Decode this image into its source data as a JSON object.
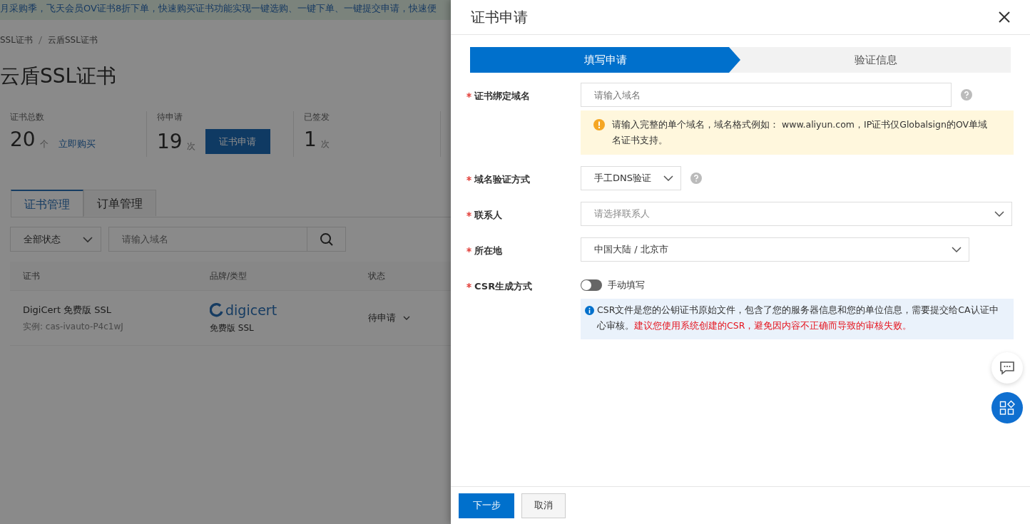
{
  "background_page": {
    "banner": "月采购季，飞天会员OV证书8折下单，快速购买证书功能实现一键选购、一键下单、一键提交申请，快速便",
    "breadcrumb": [
      "SSL证书",
      "云盾SSL证书"
    ],
    "title": "云盾SSL证书",
    "stats": [
      {
        "label": "证书总数",
        "value": "20",
        "unit": "个",
        "action": {
          "kind": "link",
          "text": "立即购买"
        }
      },
      {
        "label": "待申请",
        "value": "19",
        "unit": "次",
        "action": {
          "kind": "button",
          "text": "证书申请"
        }
      },
      {
        "label": "已签发",
        "value": "1",
        "unit": "次"
      }
    ],
    "tabs": [
      {
        "label": "证书管理",
        "selected": true
      },
      {
        "label": "订单管理",
        "selected": false
      }
    ],
    "status_filter": "全部状态",
    "search": {
      "placeholder": "请输入域名"
    },
    "table": {
      "columns": [
        "证书",
        "品牌/类型",
        "状态"
      ],
      "rows": [
        {
          "name": "DigiCert 免费版 SSL",
          "instance": "实例: cas-ivauto-P4c1wJ",
          "brand": "digicert",
          "type": "免费版 SSL",
          "status": "待申请"
        }
      ]
    }
  },
  "drawer": {
    "title": "证书申请",
    "steps": [
      {
        "label": "填写申请",
        "selected": true
      },
      {
        "label": "验证信息",
        "selected": false
      }
    ],
    "fields": [
      {
        "kind": "input",
        "label": "证书绑定域名",
        "required": true,
        "placeholder": "请输入域名",
        "help": true,
        "hint": "请输入完整的单个域名，域名格式例如： www.aliyun.com，IP证书仅Globalsign的OV单域名证书支持。"
      },
      {
        "kind": "compact-select",
        "label": "域名验证方式",
        "required": true,
        "value": "手工DNS验证",
        "help": true
      },
      {
        "kind": "full-select",
        "label": "联系人",
        "required": true,
        "placeholder": "请选择联系人"
      },
      {
        "kind": "select",
        "label": "所在地",
        "required": true,
        "value": "中国大陆 / 北京市"
      },
      {
        "kind": "switch",
        "label": "CSR生成方式",
        "required": true,
        "on": false,
        "switch_label": "手动填写",
        "note": "CSR文件是您的公钥证书原始文件，包含了您的服务器信息和您的单位信息，需要提交给CA认证中心审核。",
        "warning": "建议您使用系统创建的CSR，避免因内容不正确而导致的审核失败。"
      }
    ],
    "buttons": [
      {
        "label": "下一步",
        "primary": true
      },
      {
        "label": "取消",
        "primary": false
      }
    ]
  }
}
